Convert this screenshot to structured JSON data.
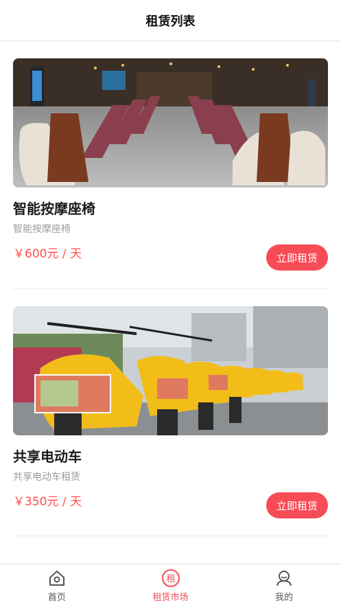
{
  "header": {
    "title": "租赁列表"
  },
  "items": [
    {
      "title": "智能按摩座椅",
      "subtitle": "智能按摩座椅",
      "price": "￥600元 / 天",
      "button": "立即租赁",
      "image_icon": "massage-chair-photo"
    },
    {
      "title": "共享电动车",
      "subtitle": "共享电动车租赁",
      "price": "￥350元 / 天",
      "button": "立即租赁",
      "image_icon": "electric-scooter-photo"
    }
  ],
  "tabbar": {
    "tabs": [
      {
        "label": "首页",
        "icon": "home-icon",
        "active": false
      },
      {
        "label": "租赁市场",
        "icon": "rent-icon",
        "active": true,
        "icon_text": "租"
      },
      {
        "label": "我的",
        "icon": "profile-icon",
        "active": false
      }
    ]
  },
  "colors": {
    "accent": "#f64c56",
    "price": "#ff4d4f"
  }
}
